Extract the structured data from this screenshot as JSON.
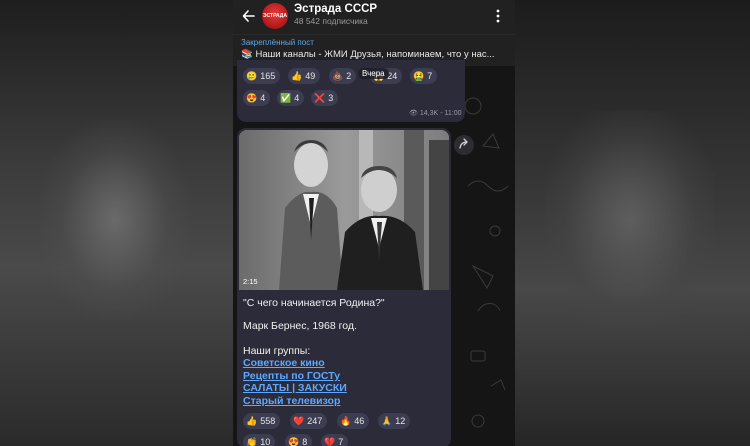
{
  "channel": {
    "name": "Эстрада СССР",
    "subscribers": "48 542 подписчика",
    "avatar_text": "ЭСТРАДА"
  },
  "pinned": {
    "label": "Закреплённый пост",
    "text": "📚 Наши каналы - ЖМИ Друзья, напоминаем, что у нас..."
  },
  "top_post": {
    "reactions_row1": [
      {
        "emoji": "🥲",
        "count": "165"
      },
      {
        "emoji": "👍",
        "count": "49"
      },
      {
        "emoji": "💩",
        "count": "2"
      },
      {
        "emoji": "😱",
        "count": "24"
      },
      {
        "emoji": "🤮",
        "count": "7"
      }
    ],
    "reactions_row2": [
      {
        "emoji": "😍",
        "count": "4"
      },
      {
        "emoji": "✅",
        "count": "4"
      },
      {
        "emoji": "❌",
        "count": "3"
      }
    ],
    "tooltip": "Вчера",
    "views": "14,3K",
    "time": "11:00"
  },
  "video_post": {
    "duration": "2:15",
    "title": "\"С чего начинается Родина?\"",
    "caption": "Марк Бернес, 1968 год.",
    "groups_label": "Наши группы:",
    "links": [
      "Советское кино",
      "Рецепты по ГОСТу",
      "САЛАТЫ | ЗАКУСКИ",
      "Старый телевизор"
    ],
    "reactions_row1": [
      {
        "emoji": "👍",
        "count": "558"
      },
      {
        "emoji": "❤️",
        "count": "247"
      },
      {
        "emoji": "🔥",
        "count": "46"
      },
      {
        "emoji": "🙏",
        "count": "12"
      }
    ],
    "reactions_row2": [
      {
        "emoji": "👏",
        "count": "10"
      },
      {
        "emoji": "😍",
        "count": "8"
      },
      {
        "emoji": "💔",
        "count": "7"
      }
    ]
  },
  "colors": {
    "link": "#5ea8ff",
    "bubble": "#2b2b3a",
    "header": "#212121"
  }
}
